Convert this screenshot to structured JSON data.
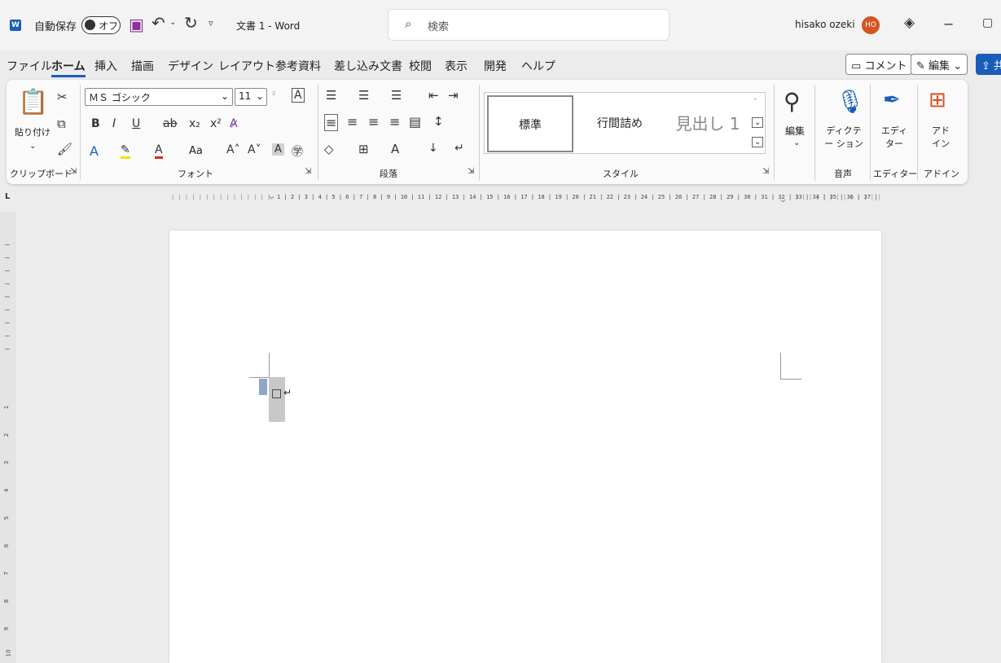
{
  "titlebar": {
    "autosave_label": "自動保存",
    "autosave_state": "オフ",
    "document_title": "文書 1  -  Word",
    "search_placeholder": "検索",
    "user_name": "hisako ozeki",
    "avatar_initials": "HO"
  },
  "menu_tabs": [
    "ファイル",
    "ホーム",
    "挿入",
    "描画",
    "デザイン",
    "レイアウト",
    "参考資料",
    "差し込み文書",
    "校閲",
    "表示",
    "開発",
    "ヘルプ"
  ],
  "active_tab": "ホーム",
  "top_buttons": {
    "comment": "コメント",
    "edit": "編集",
    "share": "共"
  },
  "ribbon": {
    "clipboard": {
      "paste": "貼り付け",
      "group_label": "クリップボード"
    },
    "font": {
      "font_name": "ＭＳ ゴシック",
      "font_size": "11",
      "group_label": "フォント",
      "aa_label": "Aa"
    },
    "paragraph": {
      "group_label": "段落"
    },
    "styles": {
      "items": [
        "標準",
        "行間詰め",
        "見出し 1"
      ],
      "group_label": "スタイル"
    },
    "editing": {
      "label": "編集"
    },
    "dictation": {
      "label": "ディクテー ション",
      "group_label": "音声"
    },
    "editor": {
      "label": "エディ ター",
      "group_label": "エディター"
    },
    "addins": {
      "label": "アド イン",
      "group_label": "アドイン"
    }
  },
  "ruler": {
    "numbers": "1 | 2 | 3 | 4 | 5 | 6 | 7 | 8 | 9 | 10 | 11 | 12 | 13 | 14 | 15 | 16 | 17 | 18 | 19 | 20 | 21 | 22 | 23 | 24 | 25 | 26 | 27 | 28 | 29 | 30 | 31 | 32 | 33 | 34 | 35 | 36 | 37 | 38"
  },
  "vertical_ruler_numbers": [
    "1",
    "2",
    "3",
    "4",
    "5",
    "6",
    "7",
    "8",
    "9",
    "10"
  ],
  "colors": {
    "accent": "#1a5db8",
    "avatar": "#d55422",
    "highlight": "#f5e400",
    "font_color": "#d62d20"
  }
}
